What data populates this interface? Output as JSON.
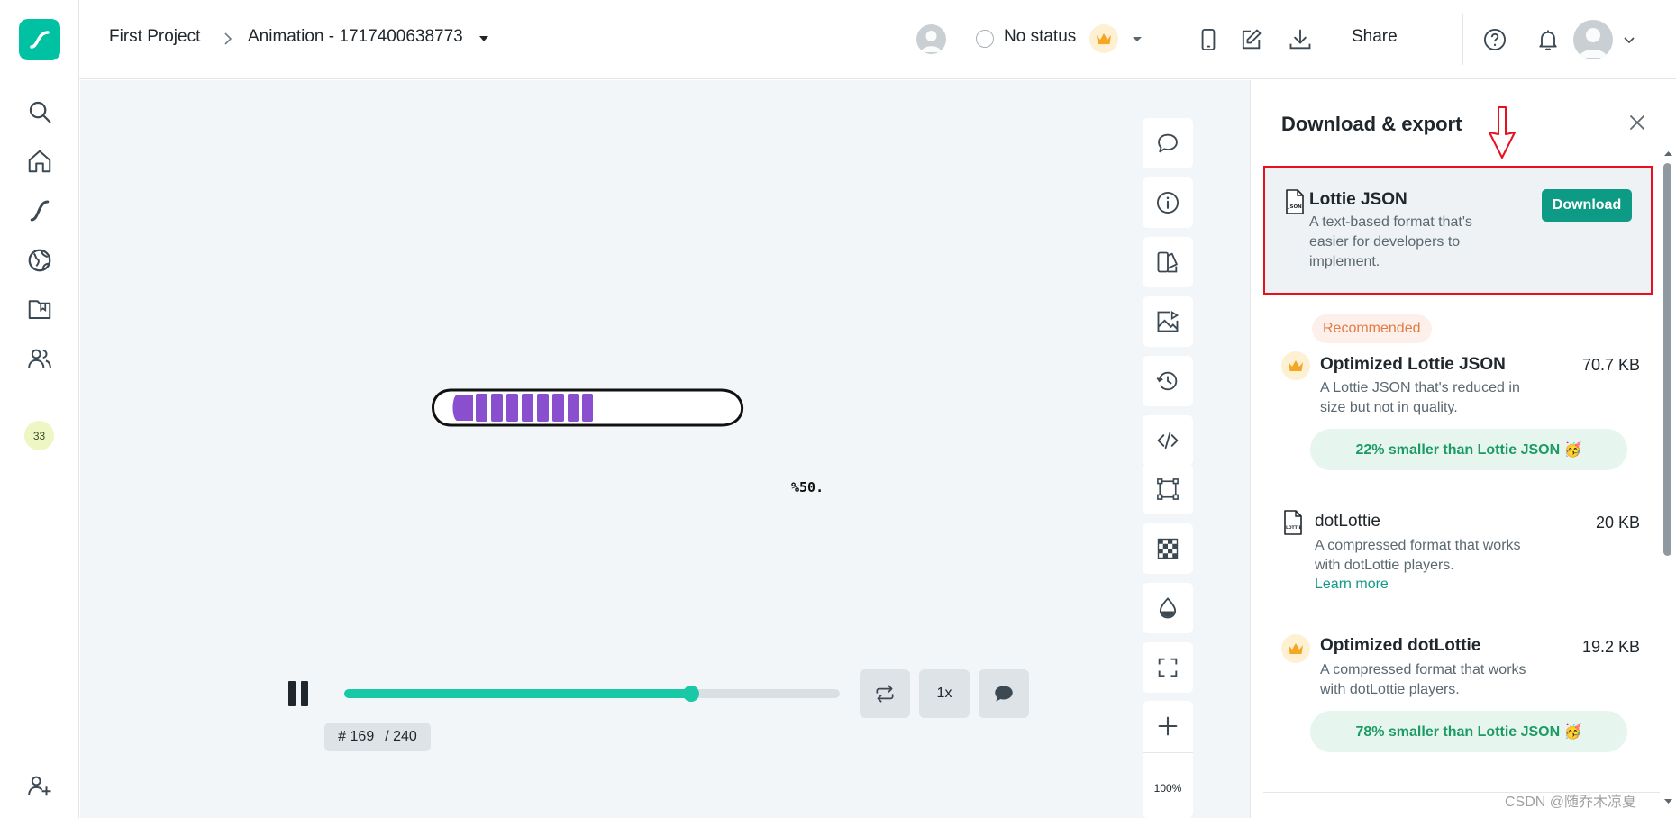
{
  "breadcrumb": {
    "project": "First Project",
    "animation": "Animation - 1717400638773"
  },
  "status": {
    "label": "No status"
  },
  "topbar": {
    "share_label": "Share"
  },
  "leftnav": {
    "badge_count": "33"
  },
  "canvas": {
    "art_label": "%50."
  },
  "zoom": {
    "level": "100%"
  },
  "player": {
    "progress_fraction": 0.7,
    "frame_current": "# 169",
    "frame_total": "/ 240",
    "speed_label": "1x"
  },
  "panel": {
    "title": "Download & export",
    "options": [
      {
        "name": "Lottie JSON",
        "description": "A text-based format that's easier for developers to implement.",
        "button_label": "Download",
        "icon": "json-file-icon"
      },
      {
        "badge": "Recommended",
        "name": "Optimized Lottie JSON",
        "size": "70.7 KB",
        "description": "A Lottie JSON that's reduced in size but not in quality.",
        "saving": "22% smaller than Lottie JSON 🥳"
      },
      {
        "name": "dotLottie",
        "size": "20 KB",
        "description": "A compressed format that works with dotLottie players.",
        "link": "Learn more",
        "icon": "lottie-file-icon"
      },
      {
        "name": "Optimized dotLottie",
        "size": "19.2 KB",
        "description": "A compressed format that works with dotLottie players.",
        "saving": "78% smaller than Lottie JSON 🥳"
      }
    ]
  },
  "watermark": "CSDN @随乔木凉夏",
  "colors": {
    "accent": "#19c9a6",
    "download_button": "#0e9b85",
    "highlight_border": "#e8101c",
    "progress_purple": "#8a4fcf"
  }
}
